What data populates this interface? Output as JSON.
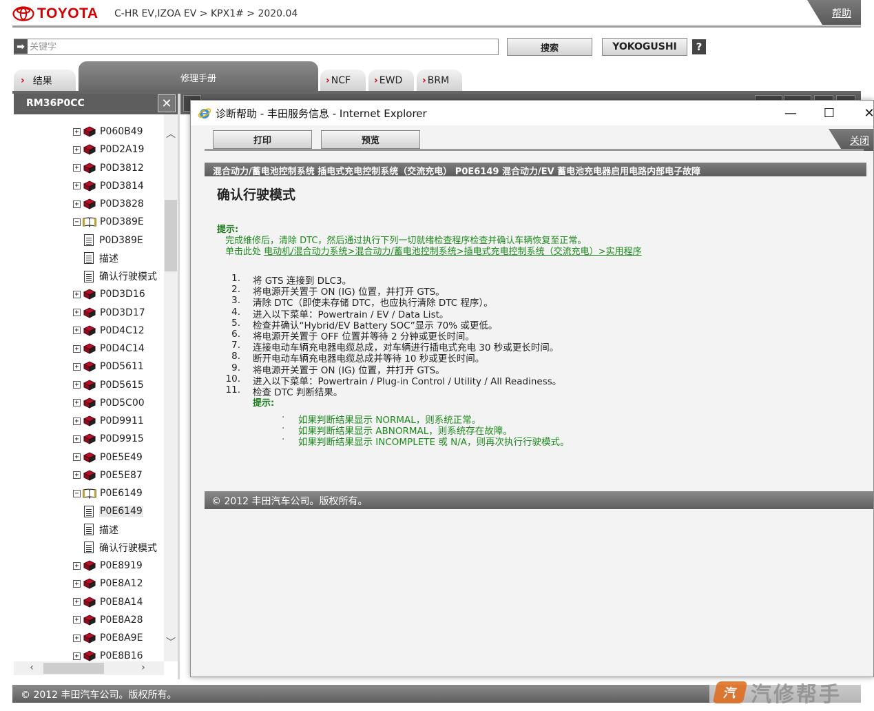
{
  "header": {
    "brand": "TOYOTA",
    "breadcrumb": "C-HR EV,IZOA EV > KPX1# > 2020.04",
    "help_label": "帮助"
  },
  "search": {
    "placeholder": "关键字",
    "search_button": "搜索",
    "yokogushi_button": "YOKOGUSHI",
    "help_glyph": "?"
  },
  "tabs": {
    "results": "结果",
    "repair_manual": "修理手册",
    "ncf": "NCF",
    "ewd": "EWD",
    "brm": "BRM"
  },
  "tree_panel": {
    "title": "RM36P0CC",
    "close_glyph": "✕",
    "items": [
      {
        "type": "book",
        "label": "P060B49",
        "expanded": false
      },
      {
        "type": "book",
        "label": "P0D2A19",
        "expanded": false
      },
      {
        "type": "book",
        "label": "P0D3812",
        "expanded": false
      },
      {
        "type": "book",
        "label": "P0D3814",
        "expanded": false
      },
      {
        "type": "book",
        "label": "P0D3828",
        "expanded": false
      },
      {
        "type": "openbook",
        "label": "P0D389E",
        "expanded": true
      },
      {
        "type": "doc",
        "label": "P0D389E"
      },
      {
        "type": "doc",
        "label": "描述"
      },
      {
        "type": "doc",
        "label": "确认行驶模式"
      },
      {
        "type": "book",
        "label": "P0D3D16",
        "expanded": false
      },
      {
        "type": "book",
        "label": "P0D3D17",
        "expanded": false
      },
      {
        "type": "book",
        "label": "P0D4C12",
        "expanded": false
      },
      {
        "type": "book",
        "label": "P0D4C14",
        "expanded": false
      },
      {
        "type": "book",
        "label": "P0D5611",
        "expanded": false
      },
      {
        "type": "book",
        "label": "P0D5615",
        "expanded": false
      },
      {
        "type": "book",
        "label": "P0D5C00",
        "expanded": false
      },
      {
        "type": "book",
        "label": "P0D9911",
        "expanded": false
      },
      {
        "type": "book",
        "label": "P0D9915",
        "expanded": false
      },
      {
        "type": "book",
        "label": "P0E5E49",
        "expanded": false
      },
      {
        "type": "book",
        "label": "P0E5E87",
        "expanded": false
      },
      {
        "type": "openbook",
        "label": "P0E6149",
        "expanded": true
      },
      {
        "type": "doc",
        "label": "P0E6149",
        "selected": true
      },
      {
        "type": "doc",
        "label": "描述"
      },
      {
        "type": "doc",
        "label": "确认行驶模式"
      },
      {
        "type": "book",
        "label": "P0E8919",
        "expanded": false
      },
      {
        "type": "book",
        "label": "P0E8A12",
        "expanded": false
      },
      {
        "type": "book",
        "label": "P0E8A14",
        "expanded": false
      },
      {
        "type": "book",
        "label": "P0E8A28",
        "expanded": false
      },
      {
        "type": "book",
        "label": "P0E8A9E",
        "expanded": false
      },
      {
        "type": "book",
        "label": "P0E8B16",
        "expanded": false
      }
    ]
  },
  "footer": {
    "copyright": "© 2012 丰田汽车公司。版权所有。"
  },
  "watermark": {
    "badge": "汽",
    "text": "汽修帮手"
  },
  "popup": {
    "title": "诊断帮助 - 丰田服务信息 - Internet Explorer",
    "minimize_glyph": "—",
    "maximize_glyph": "☐",
    "close_glyph": "✕",
    "print_button": "打印",
    "preview_button": "预览",
    "close_label": "关闭",
    "section_bar": "混合动力/蓄电池控制系统  插电式充电控制系统（交流充电）   P0E6149  混合动力/EV 蓄电池充电器启用电路内部电子故障",
    "doc_title": "确认行驶模式",
    "hint_label": "提示:",
    "hint_line1": "完成维修后，清除 DTC，然后通过执行下列一切就绪检查程序检查并确认车辆恢复至正常。",
    "hint_line2_prefix": "单击此处 ",
    "hint_line2_link": "电动机/混合动力系统>混合动力/蓄电池控制系统>插电式充电控制系统（交流充电）>实用程序",
    "steps": [
      {
        "num": "1.",
        "text": "将 GTS 连接到 DLC3。"
      },
      {
        "num": "2.",
        "text": "将电源开关置于 ON (IG) 位置，并打开 GTS。"
      },
      {
        "num": "3.",
        "text": "清除 DTC（即使未存储 DTC，也应执行清除 DTC 程序）。"
      },
      {
        "num": "4.",
        "text": "进入以下菜单：Powertrain / EV / Data List。"
      },
      {
        "num": "5.",
        "text": "检查并确认“Hybrid/EV Battery SOC”显示 70% 或更低。"
      },
      {
        "num": "6.",
        "text": "将电源开关置于 OFF 位置并等待 2 分钟或更长时间。"
      },
      {
        "num": "7.",
        "text": "连接电动车辆充电器电缆总成，对车辆进行插电式充电 30 秒或更长时间。"
      },
      {
        "num": "8.",
        "text": "断开电动车辆充电器电缆总成并等待 10 秒或更长时间。"
      },
      {
        "num": "9.",
        "text": "将电源开关置于 ON (IG) 位置，并打开 GTS。"
      },
      {
        "num": "10.",
        "text": "进入以下菜单：Powertrain / Plug-in Control / Utility / All Readiness。"
      },
      {
        "num": "11.",
        "text": "检查 DTC 判断结果。"
      }
    ],
    "sub_hint_label": "提示:",
    "sub_hints": [
      "如果判断结果显示 NORMAL，则系统正常。",
      "如果判断结果显示 ABNORMAL，则系统存在故障。",
      "如果判断结果显示 INCOMPLETE 或 N/A，则再次执行行驶模式。"
    ],
    "bullet_glyph": "·",
    "footer": "© 2012 丰田汽车公司。版权所有。"
  },
  "colors": {
    "toyota_red": "#d40000",
    "hint_green": "#1d8a1d",
    "bar_gray": "#5e5e5e"
  }
}
